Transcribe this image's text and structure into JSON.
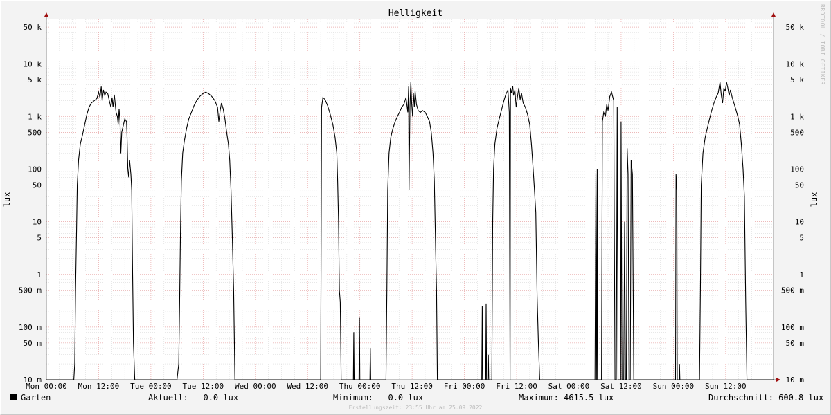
{
  "chart_data": {
    "type": "line",
    "title": "Helligkeit",
    "ylabel": "lux",
    "y_scale": "log",
    "ylim": [
      0.01,
      70000
    ],
    "y_ticks": [
      {
        "value": 50000,
        "label": "50 k"
      },
      {
        "value": 10000,
        "label": "10 k"
      },
      {
        "value": 5000,
        "label": "5 k"
      },
      {
        "value": 1000,
        "label": "1 k"
      },
      {
        "value": 500,
        "label": "500"
      },
      {
        "value": 100,
        "label": "100"
      },
      {
        "value": 50,
        "label": "50"
      },
      {
        "value": 10,
        "label": "10"
      },
      {
        "value": 5,
        "label": "5"
      },
      {
        "value": 1,
        "label": "1"
      },
      {
        "value": 0.5,
        "label": "500 m"
      },
      {
        "value": 0.1,
        "label": "100 m"
      },
      {
        "value": 0.05,
        "label": "50 m"
      },
      {
        "value": 0.01,
        "label": "10 m"
      }
    ],
    "x_unit": "hours since Mon 00:00",
    "xlim": [
      0,
      167
    ],
    "x_ticks": [
      {
        "value": 0,
        "label": "Mon 00:00"
      },
      {
        "value": 12,
        "label": "Mon 12:00"
      },
      {
        "value": 24,
        "label": "Tue 00:00"
      },
      {
        "value": 36,
        "label": "Tue 12:00"
      },
      {
        "value": 48,
        "label": "Wed 00:00"
      },
      {
        "value": 60,
        "label": "Wed 12:00"
      },
      {
        "value": 72,
        "label": "Thu 00:00"
      },
      {
        "value": 84,
        "label": "Thu 12:00"
      },
      {
        "value": 96,
        "label": "Fri 00:00"
      },
      {
        "value": 108,
        "label": "Fri 12:00"
      },
      {
        "value": 120,
        "label": "Sat 00:00"
      },
      {
        "value": 132,
        "label": "Sat 12:00"
      },
      {
        "value": 144,
        "label": "Sun 00:00"
      },
      {
        "value": 156,
        "label": "Sun 12:00"
      }
    ],
    "grid": true,
    "series": [
      {
        "name": "Garten",
        "color": "#000000",
        "points": [
          [
            0,
            0.01
          ],
          [
            6.3,
            0.01
          ],
          [
            6.5,
            0.02
          ],
          [
            6.7,
            0.5
          ],
          [
            6.9,
            5
          ],
          [
            7.1,
            50
          ],
          [
            7.4,
            150
          ],
          [
            7.8,
            300
          ],
          [
            8.3,
            450
          ],
          [
            8.8,
            700
          ],
          [
            9.3,
            1100
          ],
          [
            9.8,
            1500
          ],
          [
            10.3,
            1800
          ],
          [
            11,
            2000
          ],
          [
            11.6,
            2200
          ],
          [
            12,
            2900
          ],
          [
            12.3,
            2300
          ],
          [
            12.6,
            3700
          ],
          [
            12.8,
            2000
          ],
          [
            13.1,
            3200
          ],
          [
            13.4,
            2500
          ],
          [
            13.7,
            2900
          ],
          [
            14.1,
            2700
          ],
          [
            14.4,
            2100
          ],
          [
            14.8,
            1500
          ],
          [
            15.1,
            2300
          ],
          [
            15.3,
            1500
          ],
          [
            15.6,
            2600
          ],
          [
            16,
            1200
          ],
          [
            16.3,
            1000
          ],
          [
            16.5,
            700
          ],
          [
            16.7,
            1400
          ],
          [
            16.9,
            800
          ],
          [
            17.1,
            200
          ],
          [
            17.3,
            500
          ],
          [
            17.7,
            700
          ],
          [
            18,
            900
          ],
          [
            18.4,
            800
          ],
          [
            18.5,
            500
          ],
          [
            18.7,
            100
          ],
          [
            18.9,
            70
          ],
          [
            19.1,
            150
          ],
          [
            19.4,
            80
          ],
          [
            19.6,
            40
          ],
          [
            19.8,
            1
          ],
          [
            20,
            0.05
          ],
          [
            20.3,
            0.01
          ],
          [
            30,
            0.01
          ],
          [
            30.4,
            0.02
          ],
          [
            30.6,
            0.3
          ],
          [
            30.8,
            8
          ],
          [
            31,
            60
          ],
          [
            31.3,
            200
          ],
          [
            31.7,
            350
          ],
          [
            32.2,
            600
          ],
          [
            32.7,
            900
          ],
          [
            33.3,
            1200
          ],
          [
            33.9,
            1600
          ],
          [
            34.5,
            2000
          ],
          [
            35.2,
            2400
          ],
          [
            35.9,
            2700
          ],
          [
            36.6,
            2900
          ],
          [
            37.3,
            2700
          ],
          [
            38,
            2400
          ],
          [
            38.7,
            2000
          ],
          [
            39.3,
            1500
          ],
          [
            39.6,
            800
          ],
          [
            39.9,
            1300
          ],
          [
            40.2,
            1800
          ],
          [
            40.6,
            1400
          ],
          [
            41,
            900
          ],
          [
            41.4,
            500
          ],
          [
            41.8,
            300
          ],
          [
            42.1,
            150
          ],
          [
            42.4,
            40
          ],
          [
            42.7,
            5
          ],
          [
            43,
            0.5
          ],
          [
            43.3,
            0.01
          ],
          [
            63,
            0.01
          ],
          [
            63.2,
            1500
          ],
          [
            63.5,
            2300
          ],
          [
            64,
            2100
          ],
          [
            64.6,
            1600
          ],
          [
            65.2,
            1100
          ],
          [
            65.8,
            700
          ],
          [
            66.3,
            400
          ],
          [
            66.7,
            200
          ],
          [
            66.9,
            60
          ],
          [
            67.1,
            10
          ],
          [
            67.3,
            0.5
          ],
          [
            67.5,
            0.3
          ],
          [
            67.7,
            0.01
          ],
          [
            70.5,
            0.01
          ],
          [
            70.6,
            0.08
          ],
          [
            70.7,
            0.01
          ],
          [
            71.8,
            0.01
          ],
          [
            71.9,
            0.15
          ],
          [
            72,
            0.01
          ],
          [
            74.3,
            0.01
          ],
          [
            74.4,
            0.04
          ],
          [
            74.5,
            0.01
          ],
          [
            78,
            0.01
          ],
          [
            78.2,
            0.5
          ],
          [
            78.4,
            40
          ],
          [
            78.7,
            200
          ],
          [
            79.1,
            400
          ],
          [
            79.6,
            600
          ],
          [
            80.1,
            800
          ],
          [
            80.6,
            1000
          ],
          [
            81.1,
            1200
          ],
          [
            81.6,
            1500
          ],
          [
            82.1,
            1700
          ],
          [
            82.6,
            2300
          ],
          [
            83,
            1200
          ],
          [
            83.2,
            3700
          ],
          [
            83.3,
            40
          ],
          [
            83.5,
            1500
          ],
          [
            83.7,
            4600
          ],
          [
            83.9,
            1800
          ],
          [
            84.1,
            1000
          ],
          [
            84.3,
            2800
          ],
          [
            84.5,
            1500
          ],
          [
            84.7,
            3000
          ],
          [
            85,
            1700
          ],
          [
            85.4,
            1300
          ],
          [
            85.9,
            1200
          ],
          [
            86.4,
            1300
          ],
          [
            87,
            1200
          ],
          [
            87.5,
            1000
          ],
          [
            88,
            800
          ],
          [
            88.4,
            500
          ],
          [
            88.8,
            200
          ],
          [
            89.1,
            60
          ],
          [
            89.4,
            3
          ],
          [
            89.6,
            0.5
          ],
          [
            89.8,
            0.01
          ],
          [
            100,
            0.01
          ],
          [
            100.1,
            0.25
          ],
          [
            100.2,
            0.01
          ],
          [
            100.9,
            0.01
          ],
          [
            101,
            0.28
          ],
          [
            101.1,
            0.01
          ],
          [
            101.4,
            0.01
          ],
          [
            101.5,
            0.03
          ],
          [
            101.6,
            0.01
          ],
          [
            102.3,
            0.01
          ],
          [
            102.5,
            10
          ],
          [
            102.7,
            100
          ],
          [
            103,
            300
          ],
          [
            103.5,
            600
          ],
          [
            104,
            900
          ],
          [
            104.5,
            1300
          ],
          [
            105,
            1900
          ],
          [
            105.5,
            2600
          ],
          [
            106,
            3200
          ],
          [
            106.3,
            1200
          ],
          [
            106.5,
            0.01
          ],
          [
            106.6,
            3500
          ],
          [
            106.8,
            2800
          ],
          [
            107.1,
            3800
          ],
          [
            107.3,
            2500
          ],
          [
            107.6,
            3200
          ],
          [
            107.9,
            1500
          ],
          [
            108.2,
            2400
          ],
          [
            108.5,
            3500
          ],
          [
            108.8,
            2100
          ],
          [
            109.1,
            2800
          ],
          [
            109.5,
            1800
          ],
          [
            110,
            1500
          ],
          [
            110.5,
            1100
          ],
          [
            111,
            700
          ],
          [
            111.4,
            300
          ],
          [
            111.8,
            100
          ],
          [
            112.1,
            40
          ],
          [
            112.4,
            15
          ],
          [
            112.7,
            0.4
          ],
          [
            113,
            0.05
          ],
          [
            113.3,
            0.01
          ],
          [
            126,
            0.01
          ],
          [
            126.2,
            80
          ],
          [
            126.4,
            0.01
          ],
          [
            126.5,
            100
          ],
          [
            126.6,
            0.01
          ],
          [
            127.5,
            0.01
          ],
          [
            127.7,
            800
          ],
          [
            128,
            1200
          ],
          [
            128.4,
            1000
          ],
          [
            128.7,
            1700
          ],
          [
            129,
            1300
          ],
          [
            129.4,
            2400
          ],
          [
            129.8,
            2900
          ],
          [
            130.3,
            2000
          ],
          [
            130.6,
            0.01
          ],
          [
            130.9,
            0.01
          ],
          [
            131.1,
            1500
          ],
          [
            131.3,
            0.01
          ],
          [
            131.9,
            0.01
          ],
          [
            132,
            800
          ],
          [
            132.2,
            0.01
          ],
          [
            132.6,
            0.01
          ],
          [
            132.8,
            10
          ],
          [
            133,
            0.01
          ],
          [
            133.2,
            0.01
          ],
          [
            133.4,
            250
          ],
          [
            133.6,
            80
          ],
          [
            133.8,
            0.01
          ],
          [
            134.1,
            0.01
          ],
          [
            134.3,
            150
          ],
          [
            134.6,
            80
          ],
          [
            134.9,
            0.01
          ],
          [
            144.5,
            0.01
          ],
          [
            144.6,
            80
          ],
          [
            144.8,
            40
          ],
          [
            144.9,
            0.01
          ],
          [
            145.3,
            0.01
          ],
          [
            145.4,
            0.02
          ],
          [
            145.5,
            0.01
          ],
          [
            150,
            0.01
          ],
          [
            150.2,
            0.5
          ],
          [
            150.4,
            50
          ],
          [
            150.8,
            200
          ],
          [
            151.3,
            400
          ],
          [
            151.8,
            600
          ],
          [
            152.3,
            900
          ],
          [
            152.8,
            1300
          ],
          [
            153.3,
            1800
          ],
          [
            153.8,
            2300
          ],
          [
            154.3,
            2800
          ],
          [
            154.7,
            4500
          ],
          [
            155,
            2500
          ],
          [
            155.3,
            1800
          ],
          [
            155.6,
            3500
          ],
          [
            155.9,
            3000
          ],
          [
            156.2,
            4500
          ],
          [
            156.5,
            3500
          ],
          [
            156.8,
            2500
          ],
          [
            157.1,
            3200
          ],
          [
            157.5,
            2300
          ],
          [
            157.9,
            1800
          ],
          [
            158.3,
            1400
          ],
          [
            158.8,
            1000
          ],
          [
            159.2,
            700
          ],
          [
            159.6,
            300
          ],
          [
            160,
            100
          ],
          [
            160.3,
            30
          ],
          [
            160.6,
            0.3
          ],
          [
            160.9,
            0.01
          ],
          [
            167,
            0.01
          ]
        ]
      }
    ]
  },
  "legend": {
    "series_name": "Garten",
    "current": "Aktuell:   0.0 lux",
    "minimum": "Minimum:   0.0 lux",
    "maximum": "Maximum: 4615.5 lux",
    "average": "Durchschnitt: 600.8 lux"
  },
  "footer": "Erstellungszeit: 23:55 Uhr am 25.09.2022",
  "watermark": "RRDTOOL / TOBI OETIKER"
}
